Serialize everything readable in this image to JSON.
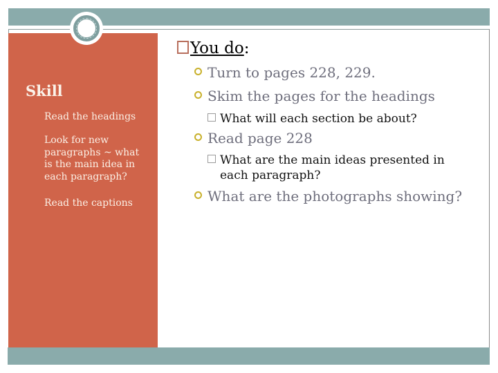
{
  "slide": {
    "colors": {
      "accent_teal": "#8aabab",
      "panel_orange": "#d0644a",
      "bullet_gold": "#c8b02a",
      "heading_box": "#b86e5c"
    },
    "sidebar": {
      "title": "Skill",
      "items": [
        "Read the headings",
        "Look for new paragraphs ~ what is the main idea in each paragraph?",
        "Read the captions"
      ]
    },
    "main": {
      "heading": "You do",
      "heading_suffix": ":",
      "bullets": [
        {
          "text": "Turn to pages 228, 229."
        },
        {
          "text": "Skim the pages for the headings"
        },
        {
          "text": "What will each section be about?",
          "level": 2
        },
        {
          "text": "Read page 228"
        },
        {
          "text": "What are the main ideas presented in each paragraph?",
          "level": 2
        },
        {
          "text": "What are the photographs showing?"
        }
      ]
    }
  }
}
